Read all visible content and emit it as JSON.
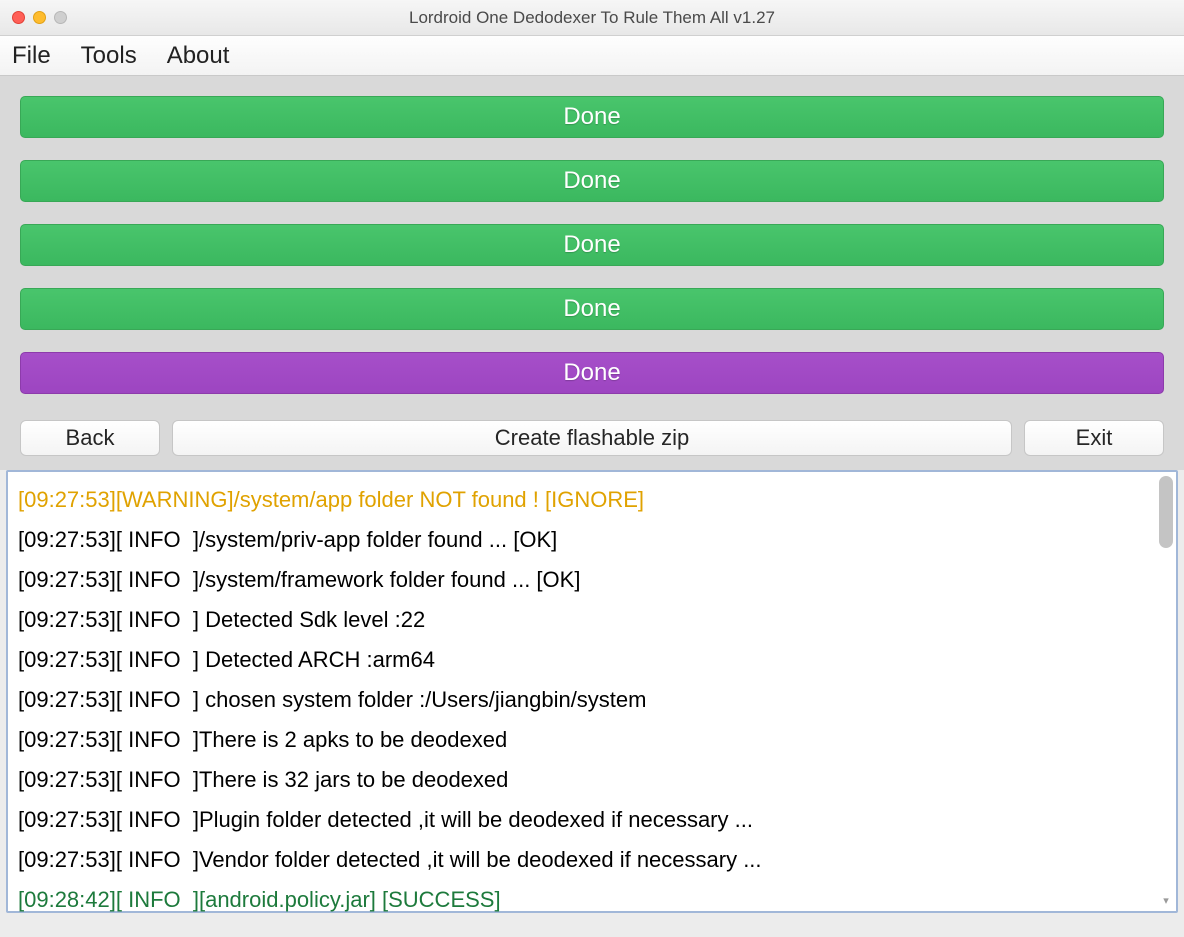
{
  "window": {
    "title": "Lordroid One Dedodexer To Rule Them All v1.27"
  },
  "menu": {
    "file": "File",
    "tools": "Tools",
    "about": "About"
  },
  "progress": {
    "bar1": "Done",
    "bar2": "Done",
    "bar3": "Done",
    "bar4": "Done",
    "bar5": "Done"
  },
  "buttons": {
    "back": "Back",
    "create": "Create flashable zip",
    "exit": "Exit"
  },
  "log": [
    {
      "level": "warning",
      "text": "[09:27:53][WARNING]/system/app folder NOT found ! [IGNORE]"
    },
    {
      "level": "info",
      "text": "[09:27:53][ INFO  ]/system/priv-app folder found ... [OK]"
    },
    {
      "level": "info",
      "text": "[09:27:53][ INFO  ]/system/framework folder found ... [OK]"
    },
    {
      "level": "info",
      "text": "[09:27:53][ INFO  ] Detected Sdk level :22"
    },
    {
      "level": "info",
      "text": "[09:27:53][ INFO  ] Detected ARCH :arm64"
    },
    {
      "level": "info",
      "text": "[09:27:53][ INFO  ] chosen system folder :/Users/jiangbin/system"
    },
    {
      "level": "info",
      "text": "[09:27:53][ INFO  ]There is 2 apks to be deodexed"
    },
    {
      "level": "info",
      "text": "[09:27:53][ INFO  ]There is 32 jars to be deodexed"
    },
    {
      "level": "info",
      "text": "[09:27:53][ INFO  ]Plugin folder detected ,it will be deodexed if necessary ..."
    },
    {
      "level": "info",
      "text": "[09:27:53][ INFO  ]Vendor folder detected ,it will be deodexed if necessary ..."
    },
    {
      "level": "success",
      "text": "[09:28:42][ INFO  ][android.policy.jar] [SUCCESS]"
    }
  ]
}
